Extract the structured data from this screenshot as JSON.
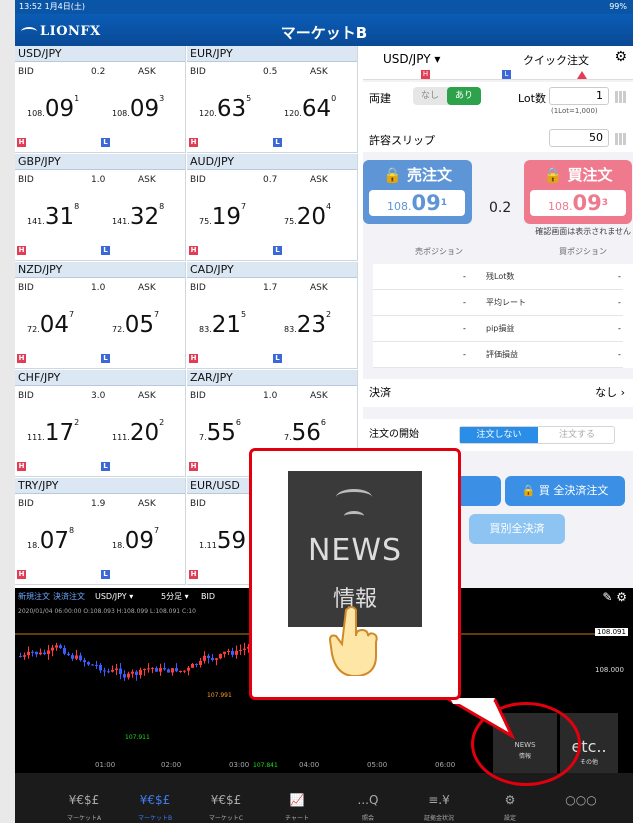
{
  "status": {
    "time_date": "13:52  1月4日(土)",
    "battery": "99%"
  },
  "header": {
    "logo": "LIONFX",
    "title": "マーケットB"
  },
  "tiles": [
    {
      "pair": "USD/JPY",
      "bid_label": "BID",
      "spread": "0.2",
      "ask_label": "ASK",
      "bid_big": "108.",
      "bid_main": "09",
      "bid_sup": "1",
      "ask_big": "108.",
      "ask_main": "09",
      "ask_sup": "3"
    },
    {
      "pair": "EUR/JPY",
      "bid_label": "BID",
      "spread": "0.5",
      "ask_label": "ASK",
      "bid_big": "120.",
      "bid_main": "63",
      "bid_sup": "5",
      "ask_big": "120.",
      "ask_main": "64",
      "ask_sup": "0"
    },
    {
      "pair": "GBP/JPY",
      "bid_label": "BID",
      "spread": "1.0",
      "ask_label": "ASK",
      "bid_big": "141.",
      "bid_main": "31",
      "bid_sup": "8",
      "ask_big": "141.",
      "ask_main": "32",
      "ask_sup": "8"
    },
    {
      "pair": "AUD/JPY",
      "bid_label": "BID",
      "spread": "0.7",
      "ask_label": "ASK",
      "bid_big": "75.",
      "bid_main": "19",
      "bid_sup": "7",
      "ask_big": "75.",
      "ask_main": "20",
      "ask_sup": "4"
    },
    {
      "pair": "NZD/JPY",
      "bid_label": "BID",
      "spread": "1.0",
      "ask_label": "ASK",
      "bid_big": "72.",
      "bid_main": "04",
      "bid_sup": "7",
      "ask_big": "72.",
      "ask_main": "05",
      "ask_sup": "7"
    },
    {
      "pair": "CAD/JPY",
      "bid_label": "BID",
      "spread": "1.7",
      "ask_label": "ASK",
      "bid_big": "83.",
      "bid_main": "21",
      "bid_sup": "5",
      "ask_big": "83.",
      "ask_main": "23",
      "ask_sup": "2"
    },
    {
      "pair": "CHF/JPY",
      "bid_label": "BID",
      "spread": "3.0",
      "ask_label": "ASK",
      "bid_big": "111.",
      "bid_main": "17",
      "bid_sup": "2",
      "ask_big": "111.",
      "ask_main": "20",
      "ask_sup": "2"
    },
    {
      "pair": "ZAR/JPY",
      "bid_label": "BID",
      "spread": "1.0",
      "ask_label": "ASK",
      "bid_big": "7.",
      "bid_main": "55",
      "bid_sup": "6",
      "ask_big": "7.",
      "ask_main": "56",
      "ask_sup": "6"
    },
    {
      "pair": "TRY/JPY",
      "bid_label": "BID",
      "spread": "1.9",
      "ask_label": "ASK",
      "bid_big": "18.",
      "bid_main": "07",
      "bid_sup": "8",
      "ask_big": "18.",
      "ask_main": "09",
      "ask_sup": "7"
    },
    {
      "pair": "EUR/USD",
      "bid_label": "BID",
      "spread": "",
      "ask_label": "",
      "bid_big": "1.11",
      "bid_main": "59",
      "bid_sup": "",
      "ask_big": "",
      "ask_main": "",
      "ask_sup": ""
    }
  ],
  "hl": {
    "h": "H",
    "l": "L"
  },
  "order_panel": {
    "pair": "USD/JPY",
    "quick": "クイック注文",
    "ryodate": "両建",
    "nashi": "なし",
    "ari": "あり",
    "lot_label": "Lot数",
    "lot_value": "1",
    "lot_note": "(1Lot=1,000)",
    "slip_label": "許容スリップ",
    "slip_value": "50",
    "sell_title": "売注文",
    "buy_title": "買注文",
    "sell_price_big": "108.",
    "sell_price_main": "09",
    "sell_price_sup": "1",
    "buy_price_big": "108.",
    "buy_price_main": "09",
    "buy_price_sup": "3",
    "spread": "0.2",
    "confirm": "確認画面は表示されません",
    "sell_pos": "売ポジション",
    "buy_pos": "買ポジション",
    "rows": [
      {
        "name": "残Lot数",
        "sell": "-",
        "buy": "-"
      },
      {
        "name": "平均レート",
        "sell": "-",
        "buy": "-"
      },
      {
        "name": "pip損益",
        "sell": "-",
        "buy": "-"
      },
      {
        "name": "評価損益",
        "sell": "-",
        "buy": "-"
      }
    ],
    "settle_label": "決済",
    "settle_value": "なし",
    "order_start_label": "注文の開始",
    "no_order": "注文しない",
    "do_order": "注文する",
    "all_settle_buy": "買 全決済注文",
    "individual_settle": "買別全決済"
  },
  "chart": {
    "new_order": "新規注文",
    "settle_order": "決済注文",
    "pair": "USD/JPY",
    "timeframe": "5分足",
    "bid": "BID",
    "ohlc": "2020/01/04 06:00:00  O:108.093  H:108.099  L:108.091  C:10",
    "y_labels": [
      "108.091",
      "108.000"
    ],
    "x_labels": [
      "01:00",
      "02:00",
      "03:00",
      "04:00",
      "05:00",
      "06:00"
    ],
    "annotations": [
      "107.991",
      "107.911",
      "107.841"
    ]
  },
  "tabs": [
    {
      "glyph": "¥€$£",
      "caption": "マーケットA"
    },
    {
      "glyph": "¥€$£",
      "caption": "マーケットB"
    },
    {
      "glyph": "¥€$£",
      "caption": "マーケットC"
    },
    {
      "glyph": "📈",
      "caption": "チャート"
    },
    {
      "glyph": "...Q",
      "caption": "照会"
    },
    {
      "glyph": "≡.¥",
      "caption": "証拠金状況"
    },
    {
      "glyph": "⚙",
      "caption": "設定"
    },
    {
      "glyph": "○○○",
      "caption": ""
    }
  ],
  "news": {
    "word": "NEWS",
    "jp": "情報",
    "small_word": "NEWS",
    "small_jp": "情報"
  },
  "etc": {
    "word": "etc..",
    "jp": "その他"
  },
  "colors": {
    "header": "#0a4fa0",
    "sell": "#5d95d6",
    "buy": "#ef7a8d",
    "highlight": "#e3000e",
    "active_tab": "#3f7cf0"
  }
}
